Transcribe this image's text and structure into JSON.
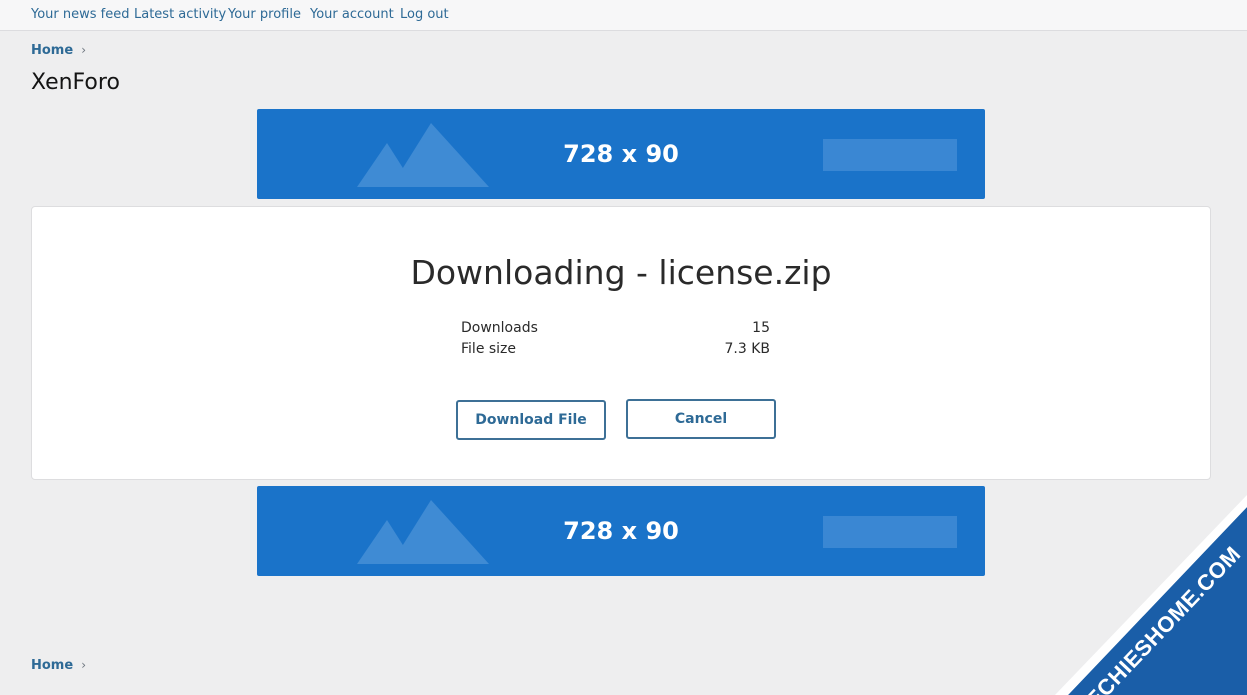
{
  "topnav": {
    "items": [
      "Your news feed",
      "Latest activity",
      "Your profile",
      "Your account",
      "Log out"
    ]
  },
  "breadcrumb": {
    "home": "Home",
    "chevron": "›"
  },
  "page": {
    "title": "XenForo"
  },
  "ads": {
    "top_label": "728 x 90",
    "bottom_label": "728 x 90"
  },
  "download": {
    "title": "Downloading - license.zip",
    "stats": [
      {
        "label": "Downloads",
        "value": "15"
      },
      {
        "label": "File size",
        "value": "7.3 KB"
      }
    ],
    "download_button": "Download File",
    "cancel_button": "Cancel"
  },
  "footer_breadcrumb": {
    "home": "Home",
    "chevron": "›"
  },
  "watermark": {
    "text": "TECHIESHOME.COM"
  },
  "colors": {
    "link": "#2e6a96",
    "ad_blue": "#1a73c9",
    "button_border": "#3d7096",
    "watermark_blue": "#1a5ea8"
  }
}
